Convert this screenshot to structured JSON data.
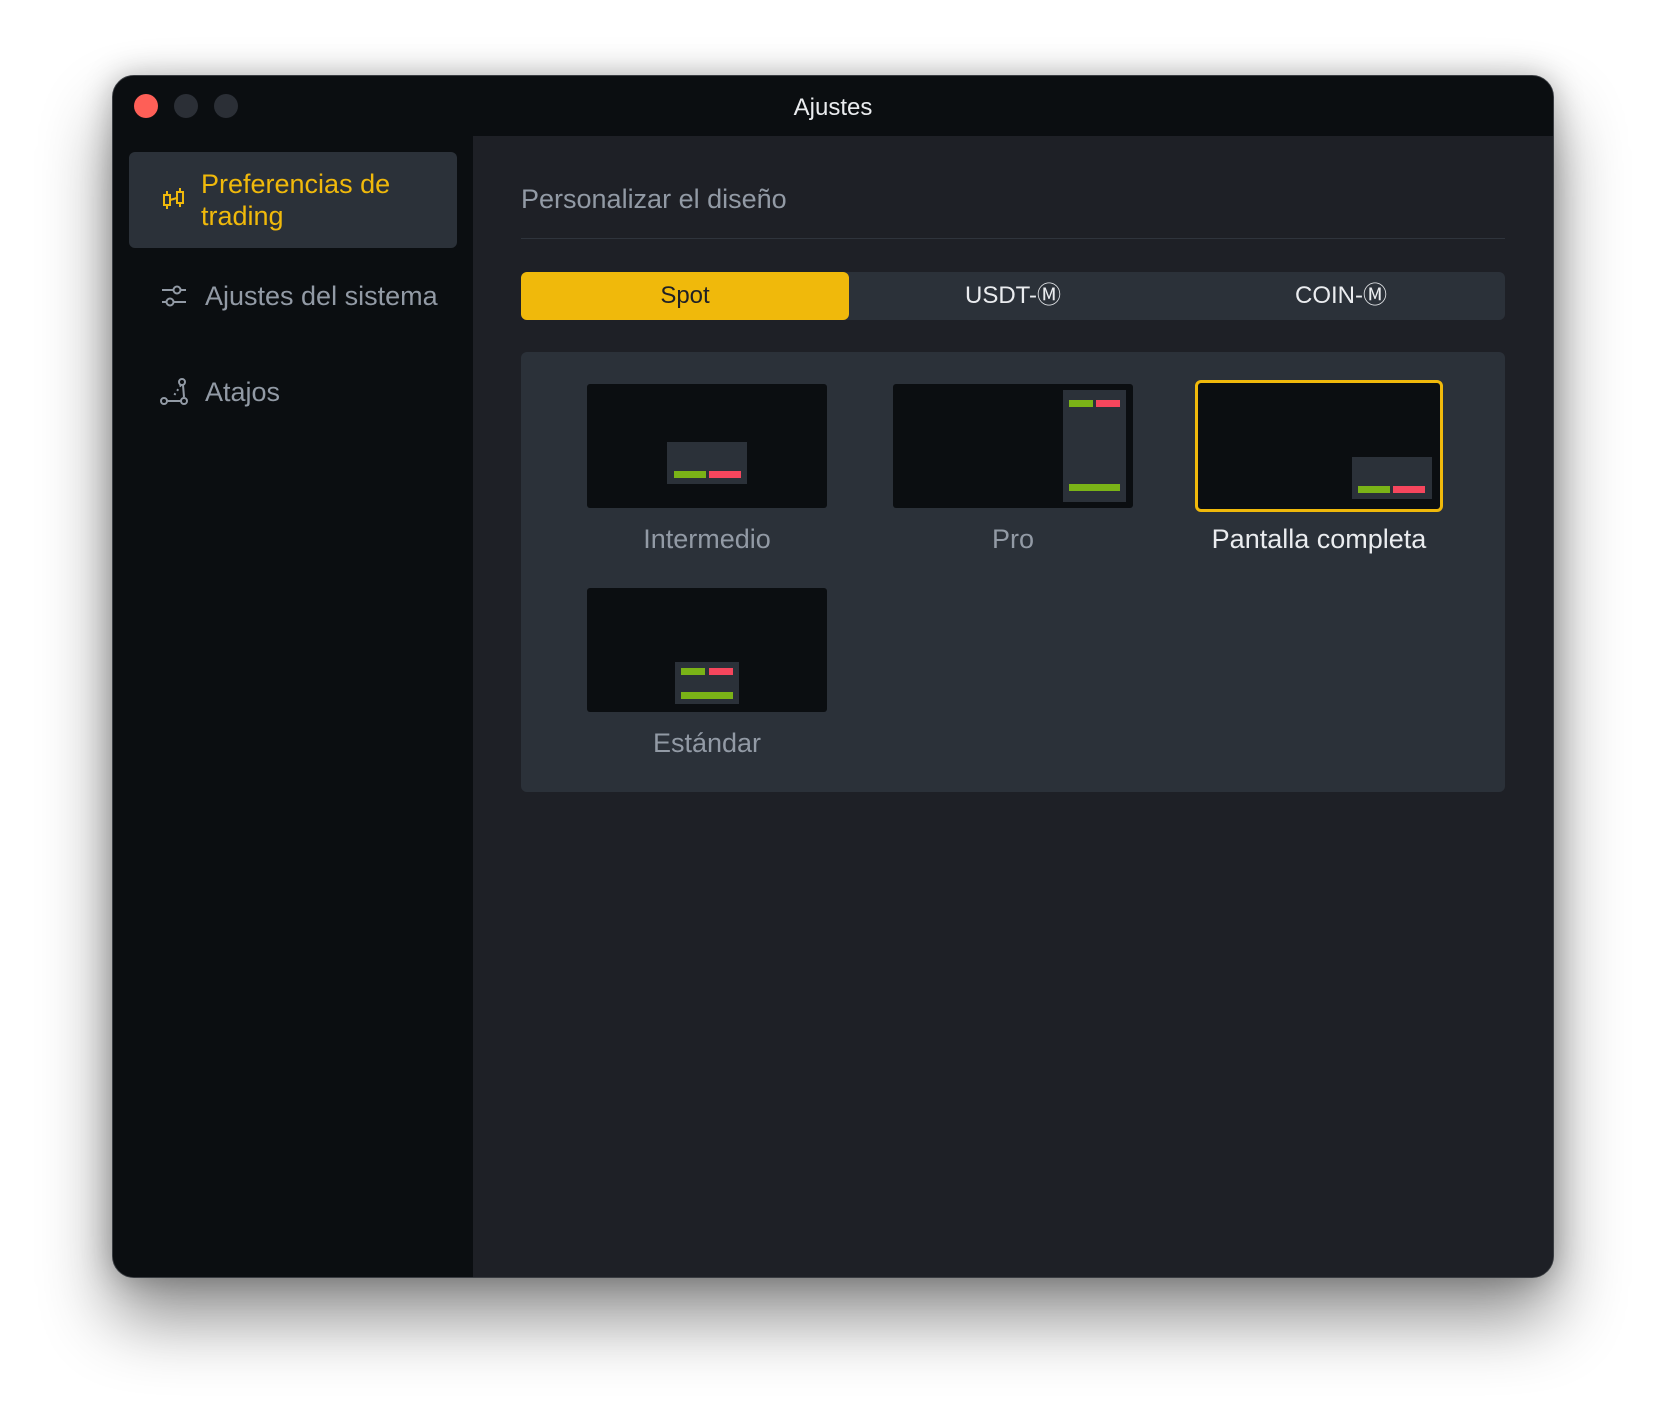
{
  "window": {
    "title": "Ajustes"
  },
  "sidebar": {
    "items": [
      {
        "label": "Preferencias de trading",
        "icon": "candlestick-icon",
        "active": true
      },
      {
        "label": "Ajustes del sistema",
        "icon": "sliders-icon",
        "active": false
      },
      {
        "label": "Atajos",
        "icon": "shortcuts-icon",
        "active": false
      }
    ]
  },
  "main": {
    "section_title": "Personalizar el diseño",
    "tabs": [
      {
        "label": "Spot",
        "active": true
      },
      {
        "label": "USDT-Ⓜ",
        "active": false
      },
      {
        "label": "COIN-Ⓜ",
        "active": false
      }
    ],
    "layouts": [
      {
        "label": "Intermedio",
        "selected": false
      },
      {
        "label": "Pro",
        "selected": false
      },
      {
        "label": "Pantalla completa",
        "selected": true
      },
      {
        "label": "Estándar",
        "selected": false
      }
    ]
  },
  "colors": {
    "accent": "#f0b90b",
    "buy": "#7ab317",
    "sell": "#f6465d",
    "close": "#fe5f57"
  }
}
